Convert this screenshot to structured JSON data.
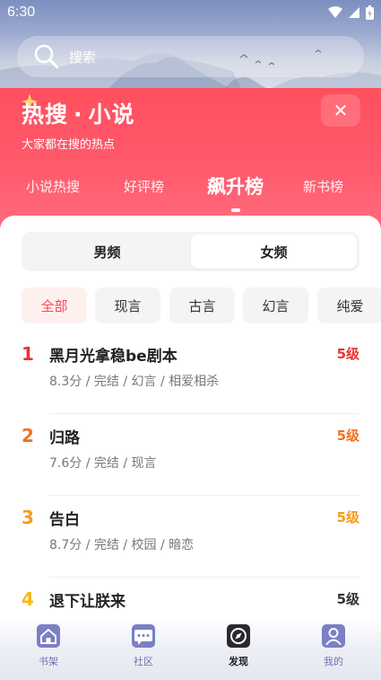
{
  "status_bar": {
    "time": "6:30"
  },
  "search": {
    "placeholder": "搜索"
  },
  "hot": {
    "title_main": "热搜",
    "title_sep": "·",
    "title_category": "小说",
    "subtitle": "大家都在搜的热点",
    "close_symbol": "✕"
  },
  "rank_tabs": [
    {
      "label": "小说热搜",
      "active": false
    },
    {
      "label": "好评榜",
      "active": false
    },
    {
      "label": "飙升榜",
      "active": true
    },
    {
      "label": "新书榜",
      "active": false
    }
  ],
  "gender": {
    "male": "男频",
    "female": "女频",
    "selected": "女频"
  },
  "genres": [
    {
      "label": "全部",
      "active": true
    },
    {
      "label": "现言",
      "active": false
    },
    {
      "label": "古言",
      "active": false
    },
    {
      "label": "幻言",
      "active": false
    },
    {
      "label": "纯爱",
      "active": false
    }
  ],
  "books": [
    {
      "rank": "1",
      "title": "黑月光拿稳be剧本",
      "meta": "8.3分 / 完结 / 幻言 / 相爱相杀",
      "level": "5级",
      "rank_color": "#e8342f",
      "level_color": "#e8342f"
    },
    {
      "rank": "2",
      "title": "归路",
      "meta": "7.6分 / 完结 / 现言",
      "level": "5级",
      "rank_color": "#f2701f",
      "level_color": "#f2701f"
    },
    {
      "rank": "3",
      "title": "告白",
      "meta": "8.7分 / 完结 / 校园 / 暗恋",
      "level": "5级",
      "rank_color": "#f59c1a",
      "level_color": "#f59c1a"
    },
    {
      "rank": "4",
      "title": "退下让朕来",
      "meta": "",
      "level": "5级",
      "rank_color": "#f5b81a",
      "level_color": "#333333"
    }
  ],
  "bottom_nav": [
    {
      "label": "书架",
      "icon": "bookshelf-home-icon",
      "active": false
    },
    {
      "label": "社区",
      "icon": "community-chat-icon",
      "active": false
    },
    {
      "label": "发现",
      "icon": "discover-compass-icon",
      "active": true
    },
    {
      "label": "我的",
      "icon": "profile-user-icon",
      "active": false
    }
  ],
  "colors": {
    "header_red": "#ff5563",
    "accent": "#ff4455",
    "nav_purple": "#6d72b3"
  }
}
